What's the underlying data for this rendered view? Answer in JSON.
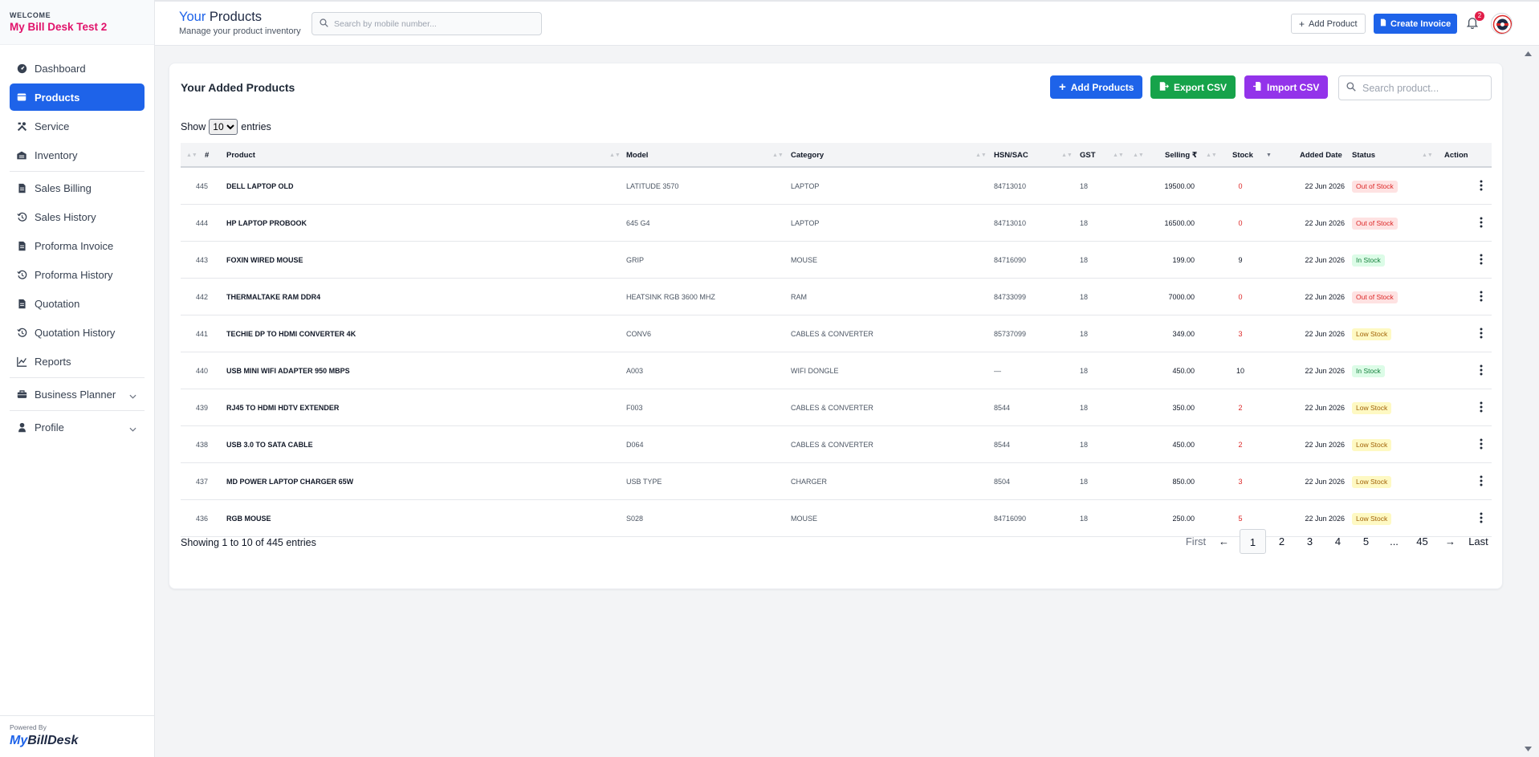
{
  "sidebar": {
    "welcome_label": "WELCOME",
    "business_name": "My Bill Desk Test 2",
    "items": [
      {
        "label": "Dashboard",
        "icon": "dashboard-icon"
      },
      {
        "label": "Products",
        "icon": "box-icon",
        "active": true
      },
      {
        "label": "Service",
        "icon": "tools-icon"
      },
      {
        "label": "Inventory",
        "icon": "warehouse-icon"
      },
      {
        "label": "Sales Billing",
        "icon": "receipt-icon"
      },
      {
        "label": "Sales History",
        "icon": "history-icon"
      },
      {
        "label": "Proforma Invoice",
        "icon": "document-icon"
      },
      {
        "label": "Proforma History",
        "icon": "history-icon"
      },
      {
        "label": "Quotation",
        "icon": "document-icon"
      },
      {
        "label": "Quotation History",
        "icon": "history-icon"
      },
      {
        "label": "Reports",
        "icon": "chart-line-icon"
      },
      {
        "label": "Business Planner",
        "icon": "briefcase-icon"
      },
      {
        "label": "Profile",
        "icon": "user-icon"
      }
    ],
    "powered_by": "Powered By",
    "logo_part1": "My",
    "logo_part2": "BillDesk"
  },
  "header": {
    "title_accent": "Your",
    "title_rest": " Products",
    "subtitle": "Manage your product inventory",
    "search_placeholder": "Search by mobile number...",
    "add_product_label": "Add Product",
    "create_invoice_label": "Create Invoice",
    "notification_count": "2"
  },
  "card": {
    "title": "Your Added Products",
    "add_products_label": "Add Products",
    "export_csv_label": "Export CSV",
    "import_csv_label": "Import CSV",
    "search_placeholder": "Search product...",
    "show_label": "Show",
    "entries_label": "entries",
    "page_size": "10",
    "columns": [
      "#",
      "Product",
      "Model",
      "Category",
      "HSN/SAC",
      "GST",
      "Selling ₹",
      "Stock",
      "Added Date",
      "Status",
      "Action"
    ],
    "rows": [
      {
        "id": "445",
        "product": "DELL LAPTOP OLD",
        "model": "LATITUDE 3570",
        "category": "LAPTOP",
        "hsn": "84713010",
        "gst": "18",
        "selling": "19500.00",
        "stock": "0",
        "stock_color": "red",
        "date": "22 Jun 2026",
        "status": "Out of Stock",
        "status_type": "out"
      },
      {
        "id": "444",
        "product": "HP LAPTOP PROBOOK",
        "model": "645 G4",
        "category": "LAPTOP",
        "hsn": "84713010",
        "gst": "18",
        "selling": "16500.00",
        "stock": "0",
        "stock_color": "red",
        "date": "22 Jun 2026",
        "status": "Out of Stock",
        "status_type": "out"
      },
      {
        "id": "443",
        "product": "FOXIN WIRED MOUSE",
        "model": "GRIP",
        "category": "MOUSE",
        "hsn": "84716090",
        "gst": "18",
        "selling": "199.00",
        "stock": "9",
        "stock_color": "dark",
        "date": "22 Jun 2026",
        "status": "In Stock",
        "status_type": "in"
      },
      {
        "id": "442",
        "product": "THERMALTAKE RAM DDR4",
        "model": "HEATSINK RGB 3600 MHZ",
        "category": "RAM",
        "hsn": "84733099",
        "gst": "18",
        "selling": "7000.00",
        "stock": "0",
        "stock_color": "red",
        "date": "22 Jun 2026",
        "status": "Out of Stock",
        "status_type": "out"
      },
      {
        "id": "441",
        "product": "TECHIE DP TO HDMI CONVERTER 4K",
        "model": "CONV6",
        "category": "CABLES & CONVERTER",
        "hsn": "85737099",
        "gst": "18",
        "selling": "349.00",
        "stock": "3",
        "stock_color": "red",
        "date": "22 Jun 2026",
        "status": "Low Stock",
        "status_type": "low"
      },
      {
        "id": "440",
        "product": "USB MINI WIFI ADAPTER 950 MBPS",
        "model": "A003",
        "category": "WIFI DONGLE",
        "hsn": "—",
        "gst": "18",
        "selling": "450.00",
        "stock": "10",
        "stock_color": "dark",
        "date": "22 Jun 2026",
        "status": "In Stock",
        "status_type": "in"
      },
      {
        "id": "439",
        "product": "RJ45 TO HDMI HDTV EXTENDER",
        "model": "F003",
        "category": "CABLES & CONVERTER",
        "hsn": "8544",
        "gst": "18",
        "selling": "350.00",
        "stock": "2",
        "stock_color": "red",
        "date": "22 Jun 2026",
        "status": "Low Stock",
        "status_type": "low"
      },
      {
        "id": "438",
        "product": "USB 3.0 TO SATA CABLE",
        "model": "D064",
        "category": "CABLES & CONVERTER",
        "hsn": "8544",
        "gst": "18",
        "selling": "450.00",
        "stock": "2",
        "stock_color": "red",
        "date": "22 Jun 2026",
        "status": "Low Stock",
        "status_type": "low"
      },
      {
        "id": "437",
        "product": "MD POWER LAPTOP CHARGER 65W",
        "model": "USB TYPE",
        "category": "CHARGER",
        "hsn": "8504",
        "gst": "18",
        "selling": "850.00",
        "stock": "3",
        "stock_color": "red",
        "date": "22 Jun 2026",
        "status": "Low Stock",
        "status_type": "low"
      },
      {
        "id": "436",
        "product": "RGB MOUSE",
        "model": "S028",
        "category": "MOUSE",
        "hsn": "84716090",
        "gst": "18",
        "selling": "250.00",
        "stock": "5",
        "stock_color": "red",
        "date": "22 Jun 2026",
        "status": "Low Stock",
        "status_type": "low"
      }
    ],
    "footer_text": "Showing 1 to 10 of 445 entries",
    "pagination": [
      "First",
      "←",
      "1",
      "2",
      "3",
      "4",
      "5",
      "...",
      "45",
      "→",
      "Last"
    ],
    "current_page": "1"
  },
  "colors": {
    "accent": "#1e63e9",
    "brand_pink": "#e1126b",
    "export_green": "#16a34a",
    "import_purple": "#9333ea",
    "stock_red": "#dc2626"
  }
}
